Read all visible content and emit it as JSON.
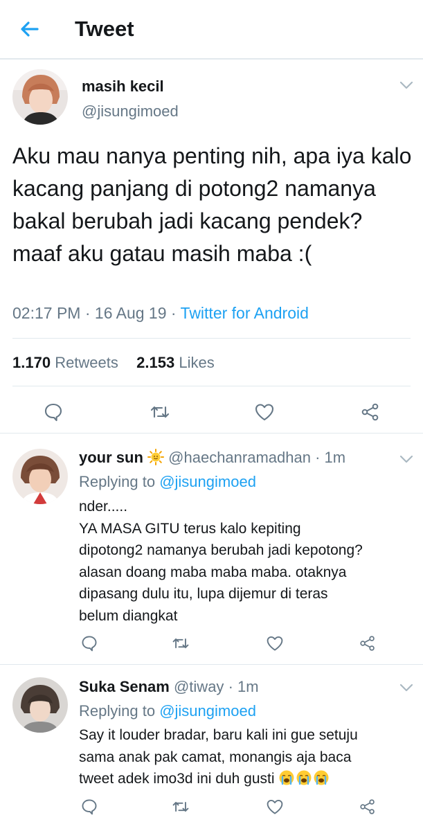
{
  "header": {
    "title": "Tweet"
  },
  "tweet": {
    "name": "masih kecil",
    "handle": "@jisungimoed",
    "text": "Aku mau nanya penting nih, apa iya kalo kacang panjang di potong2 namanya bakal berubah jadi kacang pendek? maaf aku gatau masih maba :(",
    "time": "02:17 PM",
    "date": "16 Aug 19",
    "source": "Twitter for Android",
    "retweets_count": "1.170",
    "retweets_label": "Retweets",
    "likes_count": "2.153",
    "likes_label": "Likes"
  },
  "replies": [
    {
      "name": "your sun",
      "handle": "@haechanramadhan",
      "time": "1m",
      "replying_prefix": "Replying to",
      "replying_to": "@jisungimoed",
      "text_lines": [
        "nder.....",
        "YA MASA GITU terus kalo kepiting",
        "dipotong2 namanya berubah jadi kepotong?",
        "alasan doang maba maba maba. otaknya",
        "dipasang dulu itu, lupa dijemur di teras",
        "belum diangkat"
      ]
    },
    {
      "name": "Suka Senam",
      "handle": "@tiway",
      "time": "1m",
      "replying_prefix": "Replying to",
      "replying_to": "@jisungimoed",
      "text_lines": [
        "Say it louder bradar, baru kali ini gue setuju",
        "sama anak pak camat, monangis aja baca",
        "tweet adek imo3d ini duh gusti"
      ]
    }
  ],
  "icons": {
    "back": "arrow-left-icon",
    "caret": "chevron-down-icon",
    "reply": "reply-icon",
    "retweet": "retweet-icon",
    "like": "heart-icon",
    "share": "share-icon",
    "sun_emoji": "sun-emoji-icon",
    "crying_emoji": "loudly-crying-face-emoji-icon"
  },
  "colors": {
    "accent": "#1da1f2",
    "secondary_text": "#657786",
    "divider": "#e1e8ed"
  }
}
